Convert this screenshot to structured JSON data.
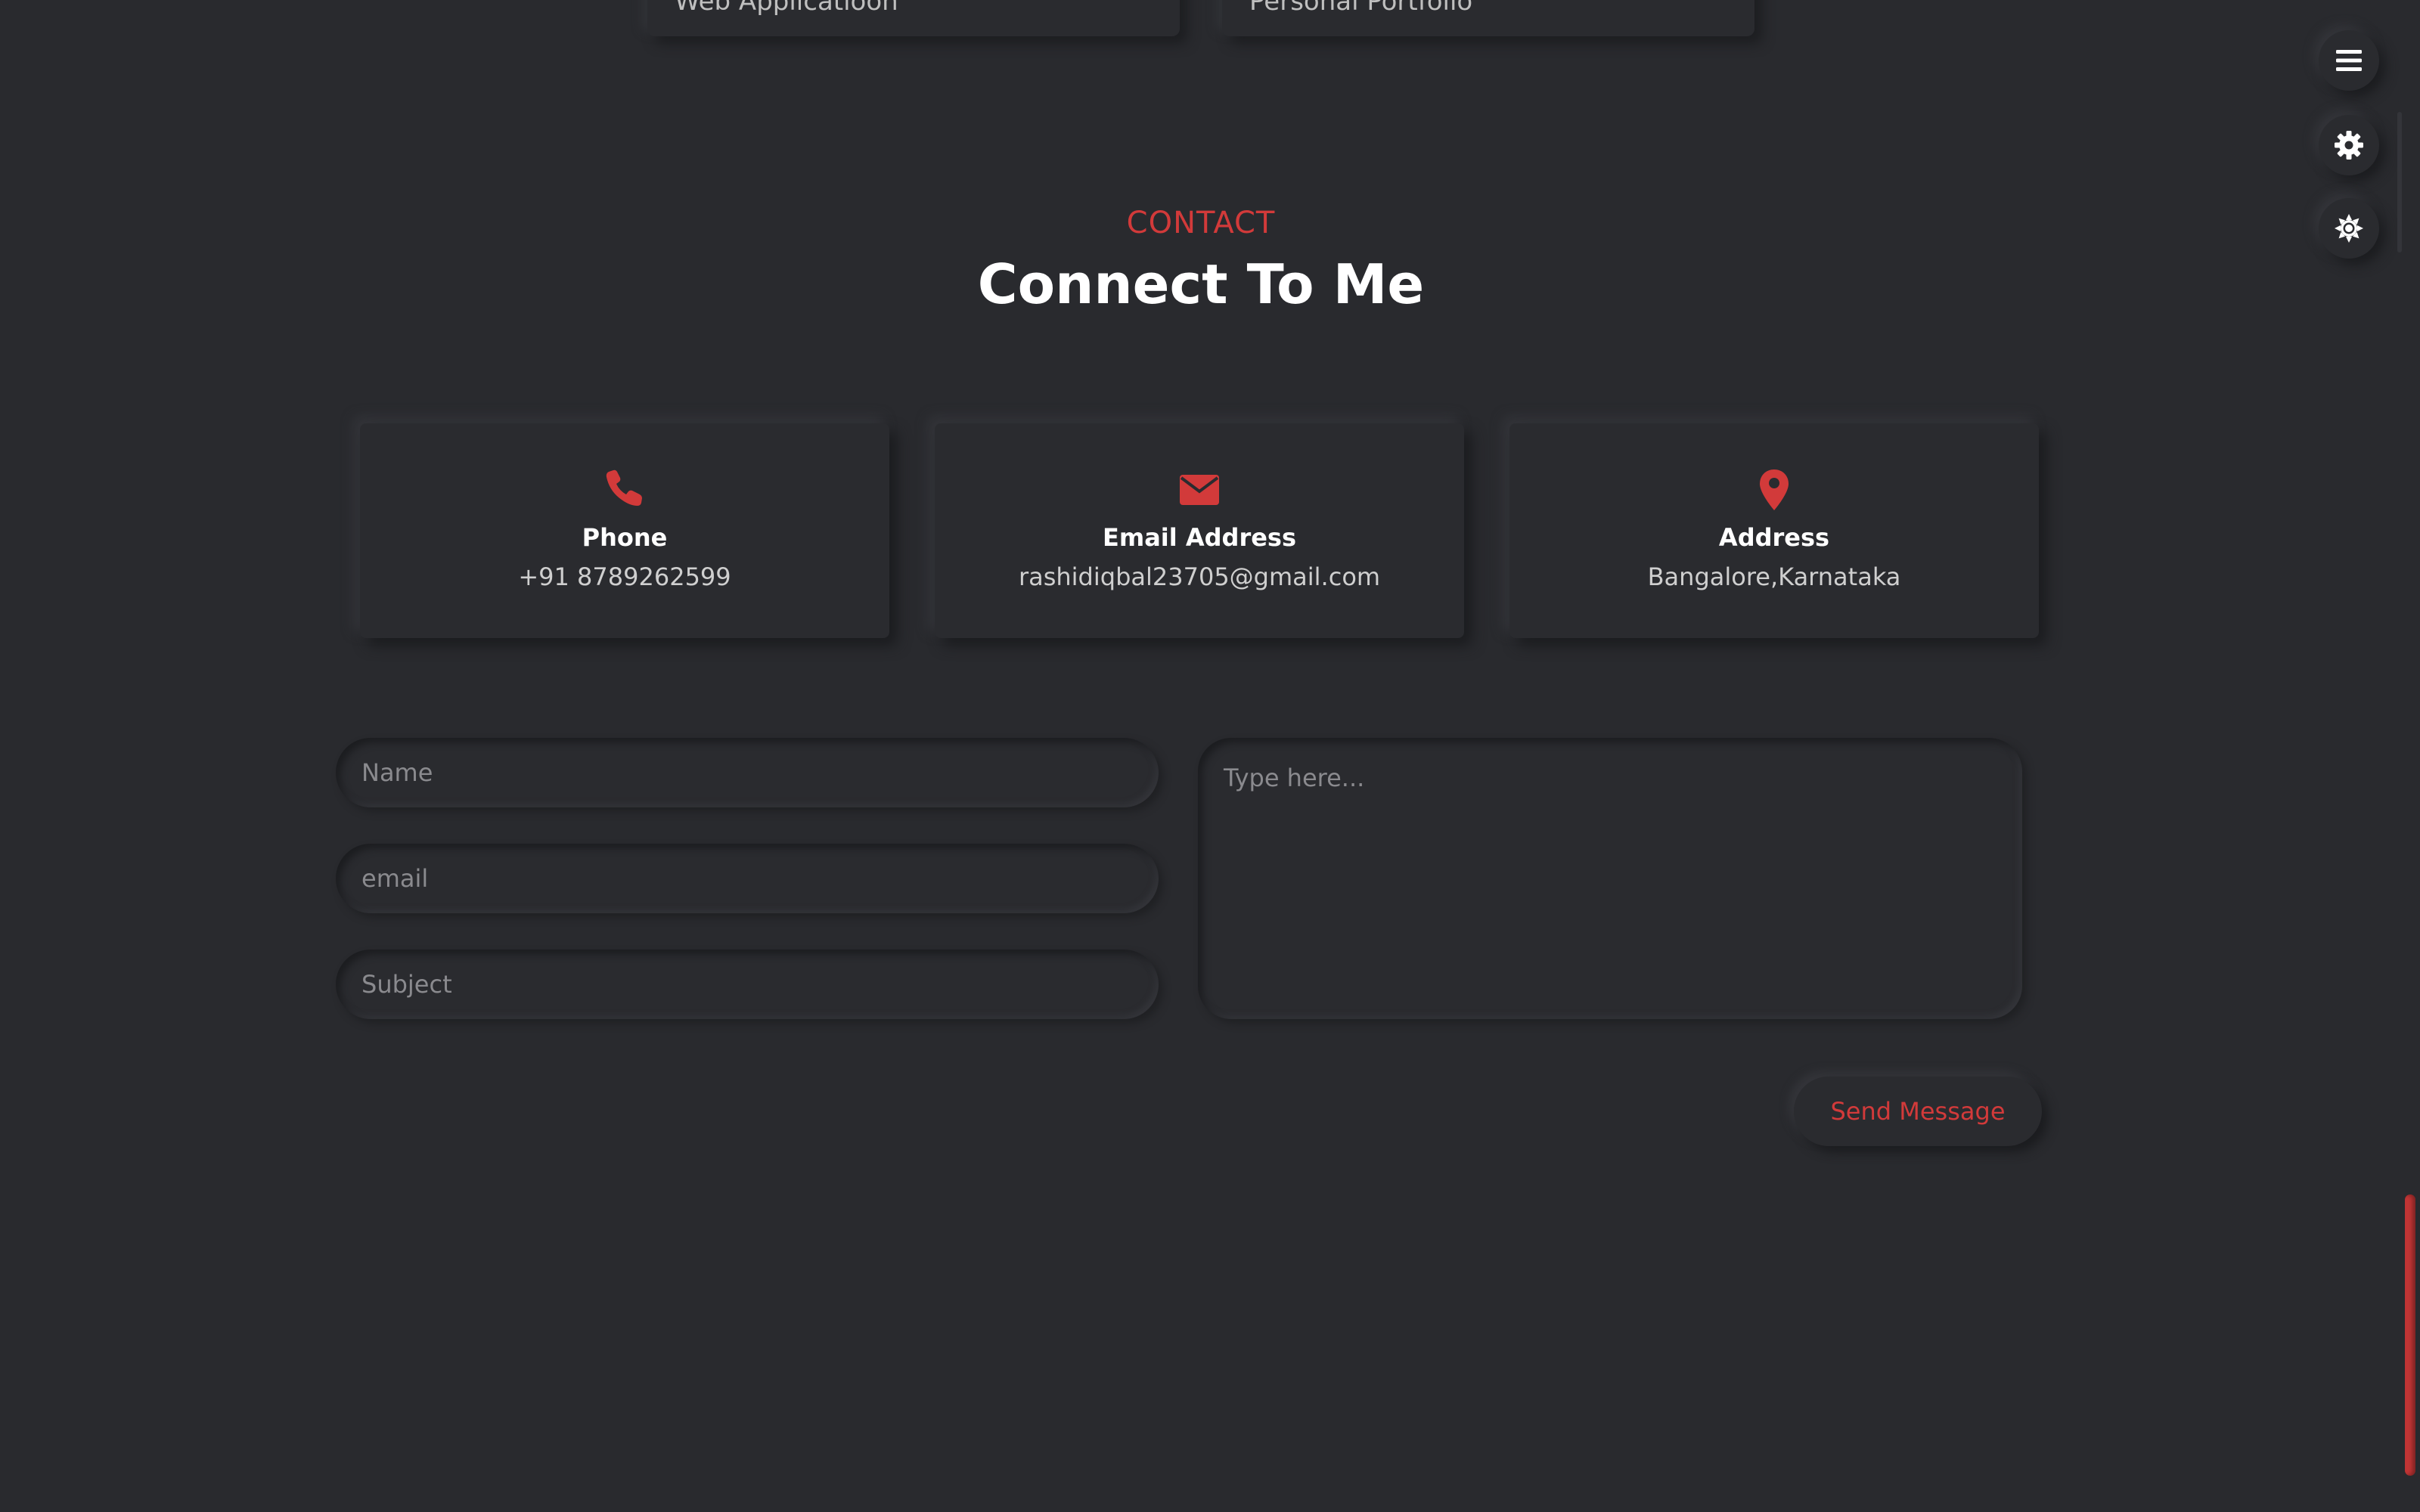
{
  "projects": {
    "cards": [
      {
        "label": "Web Applicatioon"
      },
      {
        "label": "Personal Portfolio"
      }
    ]
  },
  "fabs": {
    "menu_icon": "hamburger-menu-icon",
    "settings_icon": "gear-icon",
    "theme_icon": "sun-icon"
  },
  "contact": {
    "eyebrow": "CONTACT",
    "title": "Connect To Me",
    "cards": [
      {
        "icon": "phone-icon",
        "title": "Phone",
        "value": "+91 8789262599"
      },
      {
        "icon": "envelope-icon",
        "title": "Email Address",
        "value": "rashidiqbal23705@gmail.com"
      },
      {
        "icon": "map-pin-icon",
        "title": "Address",
        "value": "Bangalore,Karnataka"
      }
    ]
  },
  "form": {
    "name_placeholder": "Name",
    "email_placeholder": "email",
    "subject_placeholder": "Subject",
    "message_placeholder": "Type here...",
    "send_label": "Send Message"
  },
  "colors": {
    "background": "#292a2e",
    "accent": "#d23a3a",
    "heading": "#ffffff",
    "text": "#cfcfcf"
  }
}
